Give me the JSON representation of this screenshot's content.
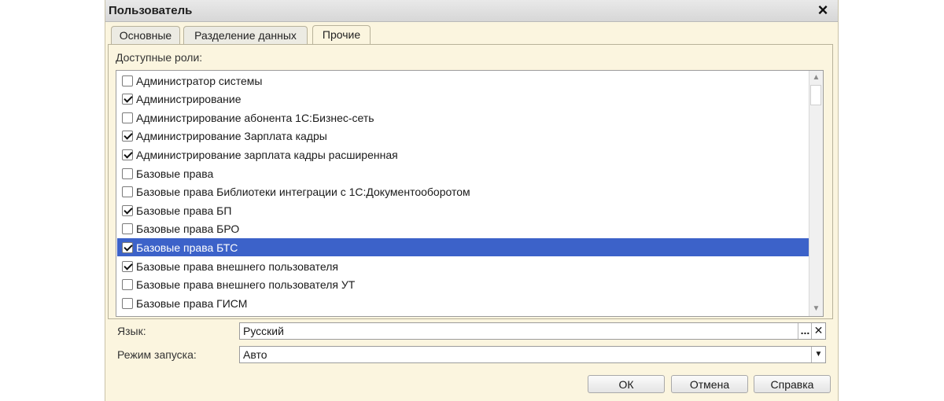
{
  "window": {
    "title": "Пользователь"
  },
  "tabs": [
    {
      "label": "Основные"
    },
    {
      "label": "Разделение данных"
    },
    {
      "label": "Прочие"
    }
  ],
  "roles": {
    "caption": "Доступные роли:",
    "items": [
      {
        "label": "Администратор системы",
        "checked": false
      },
      {
        "label": "Администрирование",
        "checked": true
      },
      {
        "label": "Администрирование абонента 1С:Бизнес-сеть",
        "checked": false
      },
      {
        "label": "Администрирование Зарплата кадры",
        "checked": true
      },
      {
        "label": "Администрирование зарплата кадры расширенная",
        "checked": true
      },
      {
        "label": "Базовые права",
        "checked": false
      },
      {
        "label": "Базовые права Библиотеки интеграции с 1С:Документооборотом",
        "checked": false
      },
      {
        "label": "Базовые права БП",
        "checked": true
      },
      {
        "label": "Базовые права БРО",
        "checked": false
      },
      {
        "label": "Базовые права БТС",
        "checked": true,
        "selected": true
      },
      {
        "label": "Базовые права внешнего пользователя",
        "checked": true
      },
      {
        "label": "Базовые права внешнего пользователя УТ",
        "checked": false
      },
      {
        "label": "Базовые права ГИСМ",
        "checked": false
      }
    ]
  },
  "language": {
    "label": "Язык:",
    "value": "Русский",
    "select_btn": "...",
    "clear_btn": "✕"
  },
  "launch_mode": {
    "label": "Режим запуска:",
    "value": "Авто"
  },
  "buttons": {
    "ok": "ОК",
    "cancel": "Отмена",
    "help": "Справка"
  },
  "colors": {
    "dialog_bg": "#fbf5df",
    "selection": "#3c62c9"
  }
}
